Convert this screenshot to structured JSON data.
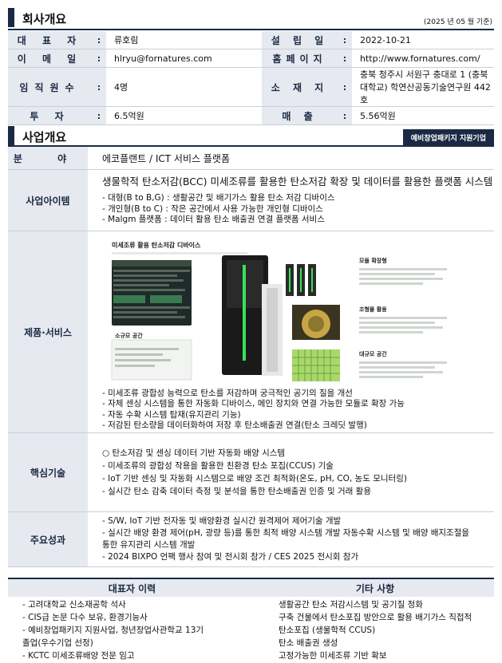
{
  "company": {
    "section_title": "회사개요",
    "date_note": "(2025 년 05 월 기준)",
    "rows": [
      {
        "l_label": "대 표 자",
        "l_value": "류호림",
        "r_label": "설 립 일",
        "r_value": "2022-10-21"
      },
      {
        "l_label": "이 메 일",
        "l_value": "hlryu@fornatures.com",
        "r_label": "홈페이지",
        "r_value": "http://www.fornatures.com/"
      },
      {
        "l_label": "임직원수",
        "l_value": "4명",
        "r_label": "소 재 지",
        "r_value": "충북 청주시 서원구 충대로 1 (충북대학교) 학연산공동기술연구원 442호"
      },
      {
        "l_label": "투 자",
        "l_value": "6.5억원",
        "r_label": "매 출",
        "r_value": "5.56억원"
      }
    ]
  },
  "business": {
    "section_title": "사업개요",
    "badge": "예비창업패키지 지원기업",
    "field_label": "분 야",
    "field_value": "에코플랜트 / ICT 서비스 플랫폼",
    "item_label": "사업아이템",
    "item_title": "생물학적 탄소저감(BCC) 미세조류를 활용한 탄소저감 확장 및 데이터를 활용한 플랫폼 시스템",
    "item_lines": [
      "- 대형(B to B,G) : 생활공간 및 배기가스 활용 탄소 저감 디바이스",
      "- 개인형(B to C) : 작은 공간에서 사용 가능한 개인형 디바이스",
      "- Malgm 플랫폼 : 데이터 활용 탄소 배출권 연결 플랫폼 서비스"
    ],
    "product_label": "제품·서비스",
    "product_image": {
      "title": "미세조류 활용 탄소저감 디바이스",
      "module": "모듈 확장형",
      "sculpture": "조형물 활용",
      "small": "소규모 공간",
      "large": "대규모 공간"
    },
    "product_lines": [
      "- 미세조류 광합성 능력으로 탄소를 저감하며 궁극적인 공기의 질을 개선",
      "- 자체 센싱 시스템을 통한 자동화 디바이스, 메인 장치와 연결 가능한 모듈로 확장 가능",
      "- 자동 수확 시스템 탑재(유지관리 기능)",
      "- 저감된 탄소량을 데이터화하여 저장 후 탄소배출권 연결(탄소 크레딧 발행)"
    ],
    "tech_label": "핵심기술",
    "tech_lines": [
      "○ 탄소저감 및 센싱 데이터 기반 자동화 배양 시스템",
      "- 미세조류의 광합성 작용을 활용한 친환경 탄소 포집(CCUS) 기술",
      "- IoT 기반 센싱 및 자동화 시스템으로 배양 조건 최적화(온도, pH, CO, 농도 모니터링)",
      "- 실시간 탄소 감축 데이터 측정 및 분석을 통한 탄소배출권 인증 및 거래 활용"
    ],
    "result_label": "주요성과",
    "result_lines": [
      "- S/W, IoT 기반 전자동 및 배양환경 실시간 원격제어 제어기술 개발",
      "- 실시간 배양 환경 제어(pH, 광량 등)를 통한 최적 배양 시스템 개발 자동수확 시스템 및 배양 배지조절을",
      "통한 유지관리 시스템 개발",
      "- 2024 BIXPO 언팩 행사 참여 및 전시회 참가 / CES 2025 전시회 참가"
    ]
  },
  "bottom": {
    "left_header": "대표자 이력",
    "right_header": "기타 사항",
    "left_lines": [
      "- 고려대학교 신소재공학 석사",
      "- CIS급 논문 다수 보유, 환경기능사",
      "- 예비창업패키지 지원사업, 청년창업사관학교 13기",
      "졸업(우수기업 선정)",
      "- KCTC 미세조류배양 전문 임고"
    ],
    "right_lines": [
      "생활공간 탄소 저감시스템 및 공기질 정화",
      "구축 건물에서 탄소포집 방안으로 활용 배기가스 직접적",
      "탄소포집 (생물학적 CCUS)",
      "탄소 배출권 생성",
      "고정가능한 미세조류 기반 확보"
    ]
  }
}
